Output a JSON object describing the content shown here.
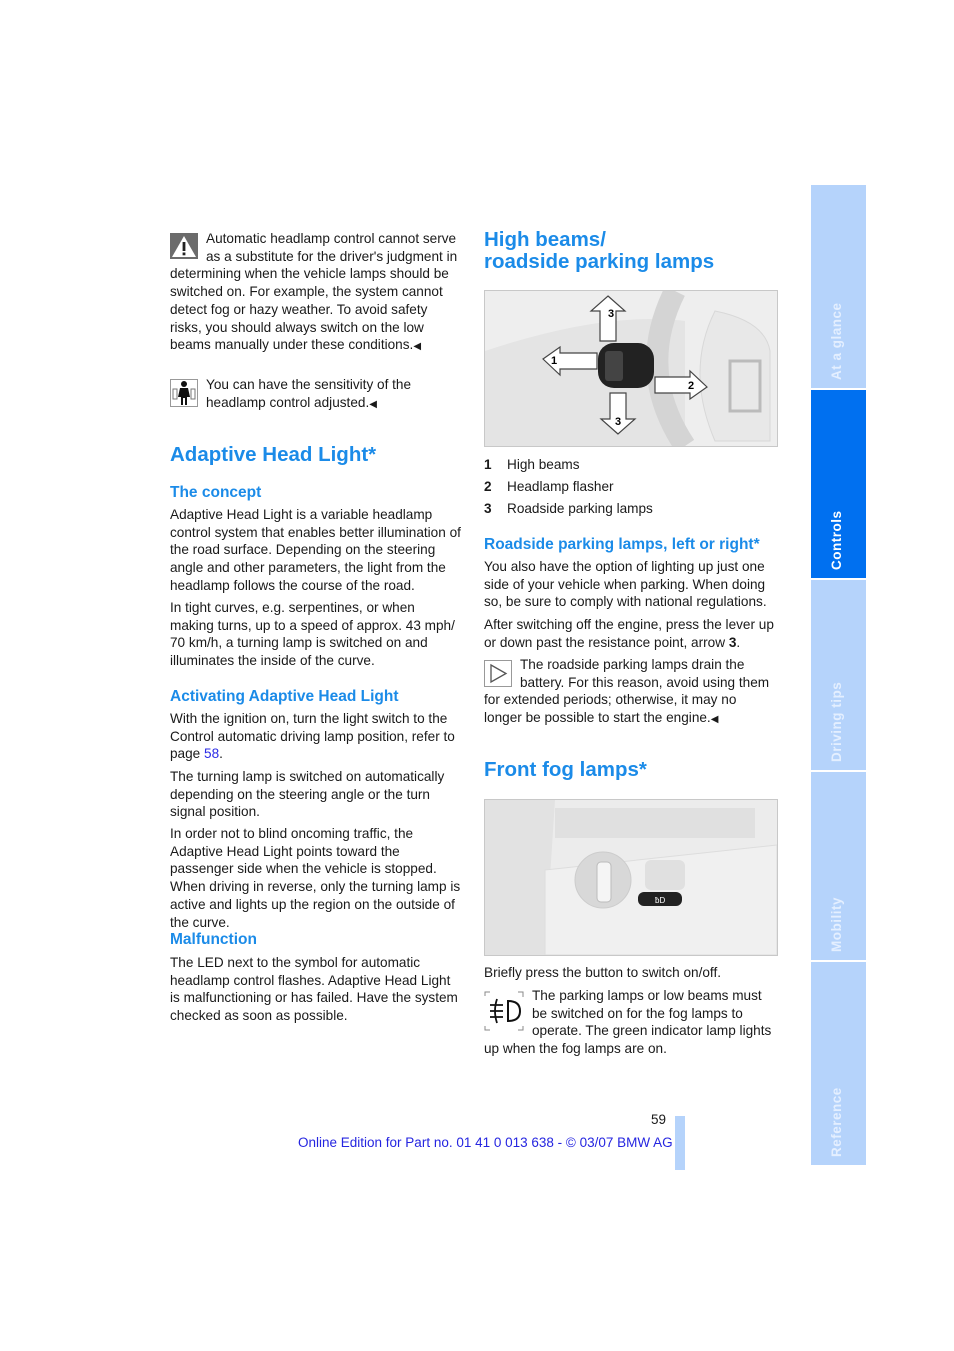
{
  "left": {
    "warning_note": "Automatic headlamp control cannot serve as a substitute for the driver's judgment in determining when the vehicle lamps should be switched on. For example, the system cannot detect fog or hazy weather. To avoid safety risks, you should always switch on the low beams manually under these conditions.",
    "service_note": "You can have the sensitivity of the headlamp control adjusted.",
    "title": "Adaptive Head Light*",
    "concept_heading": "The concept",
    "concept_p1": "Adaptive Head Light is a variable headlamp control system that enables better illumination of the road surface. Depending on the steering angle and other parameters, the light from the headlamp follows the course of the road.",
    "concept_p2": "In tight curves, e.g. serpentines, or when making turns, up to a speed of approx. 43 mph/ 70 km/h, a turning lamp is switched on and illuminates the inside of the curve.",
    "activating_heading": "Activating Adaptive Head Light",
    "activating_p1": "With the ignition on, turn the light switch to the Control automatic driving lamp position, refer to page ",
    "activating_page_link": "58",
    "activating_p1_end": ".",
    "activating_p2": "The turning lamp is switched on automatically depending on the steering angle or the turn signal position.",
    "activating_p3": "In order not to blind oncoming traffic, the Adaptive Head Light points toward the passenger side when the vehicle is stopped. When driving in reverse, only the turning lamp is active and lights up the region on the outside of the curve.",
    "malfunction_heading": "Malfunction",
    "malfunction_p": "The LED next to the symbol for automatic headlamp control flashes. Adaptive Head Light is malfunctioning or has failed. Have the system checked as soon as possible."
  },
  "right": {
    "title_line1": "High beams/",
    "title_line2": "roadside parking lamps",
    "figure1_labels": [
      "1",
      "2",
      "3",
      "3"
    ],
    "legend": [
      {
        "num": "1",
        "label": "High beams"
      },
      {
        "num": "2",
        "label": "Headlamp flasher"
      },
      {
        "num": "3",
        "label": "Roadside parking lamps"
      }
    ],
    "roadside_heading": "Roadside parking lamps, left or right*",
    "roadside_p1": "You also have the option of lighting up just one side of your vehicle when parking. When doing so, be sure to comply with national regulations.",
    "roadside_p2": "After switching off the engine, press the lever up or down past the resistance point, arrow ",
    "roadside_p2_arrow": "3",
    "roadside_p2_end": ".",
    "battery_note": "The roadside parking lamps drain the battery. For this reason, avoid using them for extended periods; otherwise, it may no longer be possible to start the engine.",
    "fog_title": "Front fog lamps*",
    "fog_p1": "Briefly press the button to switch on/off.",
    "fog_note": "The parking lamps or low beams must be switched on for the fog lamps to operate. The green indicator lamp lights up when the fog lamps are on."
  },
  "end_marker": "◀",
  "side_tabs": [
    {
      "label": "At a glance",
      "active": false
    },
    {
      "label": "Controls",
      "active": true
    },
    {
      "label": "Driving tips",
      "active": false
    },
    {
      "label": "Mobility",
      "active": false
    },
    {
      "label": "Reference",
      "active": false
    }
  ],
  "page_number": "59",
  "footer": "Online Edition for Part no. 01 41 0 013 638 - © 03/07 BMW AG",
  "colors": {
    "heading": "#1b8be8",
    "tab": "#b5d3fb",
    "tab_active": "#0070f0",
    "footer": "#2525e0"
  }
}
